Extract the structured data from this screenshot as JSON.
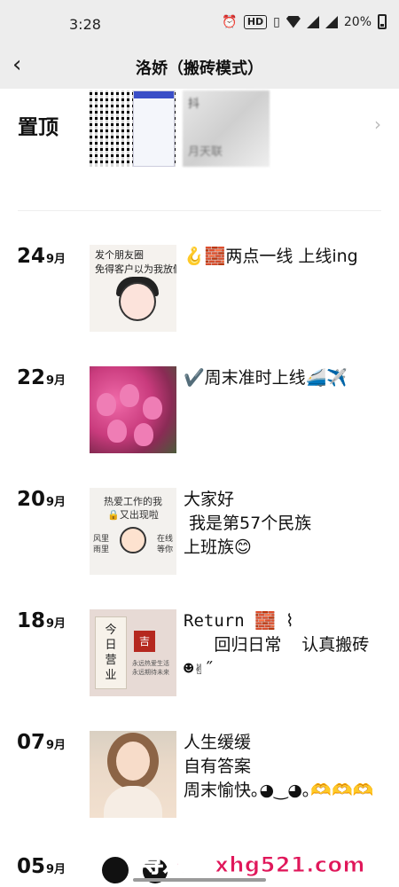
{
  "status_bar": {
    "time": "3:28",
    "battery": "20%",
    "network": "4G",
    "hd": "HD"
  },
  "header": {
    "back_icon": "chevron-left-icon",
    "title": "洛娇（搬砖模式）"
  },
  "pinned": {
    "label": "置顶",
    "preview_text_top": "抖",
    "preview_text_bottom": "月天联"
  },
  "posts": [
    {
      "day": "24",
      "month": "9月",
      "text": "🪝🧱两点一线 上线ing",
      "thumb_caption": "发个朋友圈\n免得客户以为我放假"
    },
    {
      "day": "22",
      "month": "9月",
      "text": "✔️周末准时上线🚄✈️"
    },
    {
      "day": "20",
      "month": "9月",
      "text": "大家好\n 我是第57个民族\n上班族😊",
      "thumb_caption": "热爱工作的我\n🔒又出现啦",
      "thumb_left": "风里\n雨里",
      "thumb_right": "在线\n等你"
    },
    {
      "day": "18",
      "month": "9月",
      "text": "Return 🧱 ⌇\n   回归日常  认真搬砖\n☻✌︎˝",
      "thumb_card": "今\n日\n营\n业",
      "thumb_seal": "吉",
      "thumb_note": "永远热爱生活\n永远期待未来"
    },
    {
      "day": "07",
      "month": "9月",
      "text": "人生缓缓\n自有答案\n周末愉快｡◕‿◕｡🫶🫶🫶"
    }
  ],
  "partial_post": {
    "day": "05",
    "month": "9月"
  },
  "watermark": "寻欢阁 xhg521.com"
}
